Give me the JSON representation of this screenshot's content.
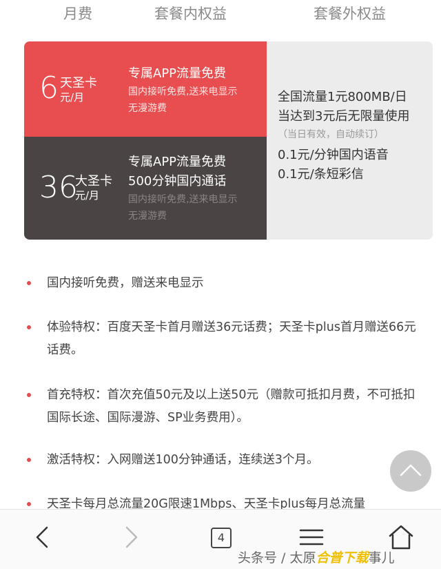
{
  "headers": {
    "monthly": "月费",
    "inner_benefits": "套餐内权益",
    "outer_benefits": "套餐外权益"
  },
  "plans": [
    {
      "price": "6",
      "name": "天圣卡",
      "unit": "元/月",
      "benefits": [
        "专属APP流量免费"
      ],
      "sub": [
        "国内接听免费,送来电显示",
        "无漫游费"
      ],
      "color": "#e84d4f"
    },
    {
      "price": "36",
      "name": "大圣卡",
      "unit": "元/月",
      "benefits": [
        "专属APP流量免费",
        "500分钟国内通话"
      ],
      "sub": [
        "国内接听免费,送来电显示",
        "无漫游费"
      ],
      "color": "#4a4544"
    }
  ],
  "outer": {
    "line1": "全国流量1元800MB/日",
    "line2": "当达到3元后无限量使用",
    "note": "（当日有效，自动续订）",
    "line3": "0.1元/分钟国内语音",
    "line4": "0.1元/条短彩信"
  },
  "bullets": [
    "国内接听免费，赠送来电显示",
    "体验特权：百度天圣卡首月赠送36元话费；天圣卡plus首月赠送66元话费。",
    "首充特权：首次充值50元及以上送50元（赠款可抵扣月费，不可抵扣国际长途、国际漫游、SP业务费用）。",
    "激活特权：入网赠送100分钟通话，连续送3个月。",
    "天圣卡每月总流量20G限速1Mbps、天圣卡plus每月总流量"
  ],
  "nav": {
    "back_icon": "chevron-left-icon",
    "forward_icon": "chevron-right-icon",
    "tab_count": "4",
    "menu_icon": "menu-icon",
    "home_icon": "home-icon"
  },
  "watermark": {
    "prefix": "头条号 / 太原",
    "brand": "合普下载",
    "suffix": "事儿"
  },
  "accent_color": "#e84d4f"
}
